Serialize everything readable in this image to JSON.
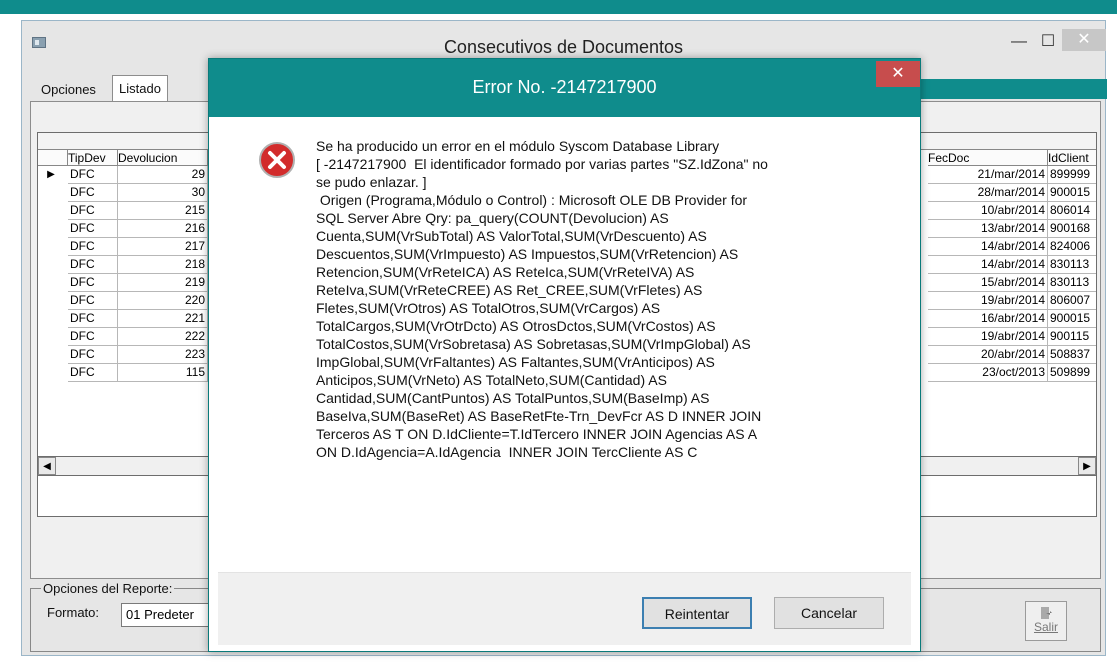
{
  "main_window": {
    "title": "Consecutivos de Documentos",
    "controls": {
      "minimize": "—",
      "maximize": "☐",
      "close": "✕"
    }
  },
  "tabs": [
    {
      "label": "Opciones"
    },
    {
      "label": "Listado",
      "selected": true
    }
  ],
  "grid": {
    "headers_left": [
      "TipDev",
      "Devolucion"
    ],
    "headers_right": [
      "FecDoc",
      "IdClient"
    ],
    "rows": [
      {
        "tip": "DFC",
        "dev": "29",
        "fec": "21/mar/2014",
        "id": "899999"
      },
      {
        "tip": "DFC",
        "dev": "30",
        "fec": "28/mar/2014",
        "id": "900015"
      },
      {
        "tip": "DFC",
        "dev": "215",
        "fec": "10/abr/2014",
        "id": "806014"
      },
      {
        "tip": "DFC",
        "dev": "216",
        "fec": "13/abr/2014",
        "id": "900168"
      },
      {
        "tip": "DFC",
        "dev": "217",
        "fec": "14/abr/2014",
        "id": "824006"
      },
      {
        "tip": "DFC",
        "dev": "218",
        "fec": "14/abr/2014",
        "id": "830113"
      },
      {
        "tip": "DFC",
        "dev": "219",
        "fec": "15/abr/2014",
        "id": "830113"
      },
      {
        "tip": "DFC",
        "dev": "220",
        "fec": "19/abr/2014",
        "id": "806007"
      },
      {
        "tip": "DFC",
        "dev": "221",
        "fec": "16/abr/2014",
        "id": "900015"
      },
      {
        "tip": "DFC",
        "dev": "222",
        "fec": "19/abr/2014",
        "id": "900115"
      },
      {
        "tip": "DFC",
        "dev": "223",
        "fec": "20/abr/2014",
        "id": "508837"
      },
      {
        "tip": "DFC",
        "dev": "115",
        "fec": "23/oct/2013",
        "id": "509899"
      }
    ],
    "selected_row_marker": "▶"
  },
  "options": {
    "legend": "Opciones del Reporte:",
    "format_label": "Formato:",
    "format_value": "01 Predeter",
    "exit_label": "Salir"
  },
  "dialog": {
    "title": "Error No. -2147217900",
    "close": "✕",
    "message": "Se ha producido un error en el módulo Syscom Database Library\n[ -2147217900  El identificador formado por varias partes \"SZ.IdZona\" no\nse pudo enlazar. ]\n Origen (Programa,Módulo o Control) : Microsoft OLE DB Provider for\nSQL Server Abre Qry: pa_query(COUNT(Devolucion) AS\nCuenta,SUM(VrSubTotal) AS ValorTotal,SUM(VrDescuento) AS\nDescuentos,SUM(VrImpuesto) AS Impuestos,SUM(VrRetencion) AS\nRetencion,SUM(VrReteICA) AS ReteIca,SUM(VrReteIVA) AS\nReteIva,SUM(VrReteCREE) AS Ret_CREE,SUM(VrFletes) AS\nFletes,SUM(VrOtros) AS TotalOtros,SUM(VrCargos) AS\nTotalCargos,SUM(VrOtrDcto) AS OtrosDctos,SUM(VrCostos) AS\nTotalCostos,SUM(VrSobretasa) AS Sobretasas,SUM(VrImpGlobal) AS\nImpGlobal,SUM(VrFaltantes) AS Faltantes,SUM(VrAnticipos) AS\nAnticipos,SUM(VrNeto) AS TotalNeto,SUM(Cantidad) AS\nCantidad,SUM(CantPuntos) AS TotalPuntos,SUM(BaseImp) AS\nBaseIva,SUM(BaseRet) AS BaseRetFte-Trn_DevFcr AS D INNER JOIN\nTerceros AS T ON D.IdCliente=T.IdTercero INNER JOIN Agencias AS A\nON D.IdAgencia=A.IdAgencia  INNER JOIN TercCliente AS C",
    "buttons": {
      "retry": "Reintentar",
      "cancel": "Cancelar"
    }
  }
}
